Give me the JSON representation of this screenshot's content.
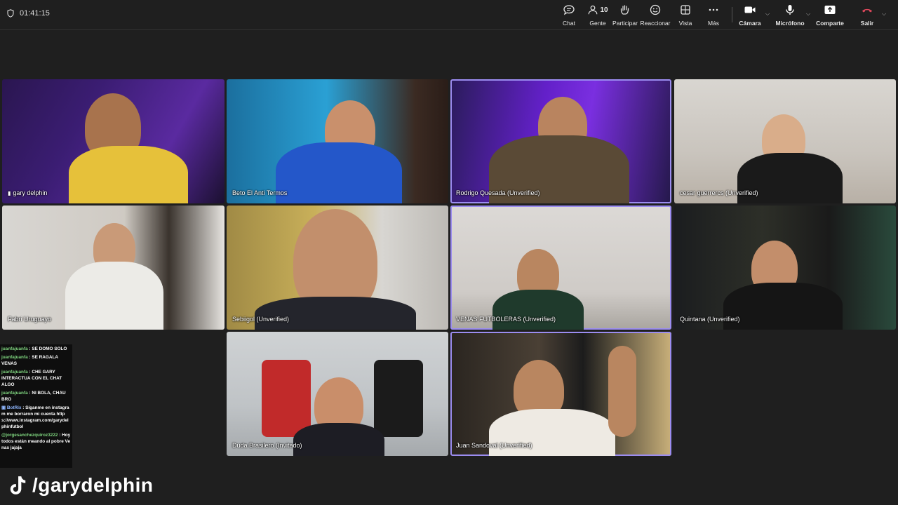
{
  "meeting": {
    "timer": "01:41:15"
  },
  "toolbar": {
    "chat": "Chat",
    "people": "Gente",
    "people_count": "10",
    "raise": "Participar",
    "react": "Reaccionar",
    "view": "Vista",
    "more": "Más",
    "camera": "Cámara",
    "mic": "Micrófono",
    "share": "Comparte",
    "leave": "Salir"
  },
  "participants": [
    {
      "name": "gary delphin"
    },
    {
      "name": "Beto El Anti Termos"
    },
    {
      "name": "Rodrigo Quesada (Unverified)"
    },
    {
      "name": "cesar guerrercs (Unverified)"
    },
    {
      "name": "Fabri Uruguayo"
    },
    {
      "name": "Sebiigol (Unverified)"
    },
    {
      "name": "VENAS FUTBOLERAS (Unverified)"
    },
    {
      "name": "Quintana (Unverified)"
    },
    {
      "name": "Duda Brasilero (Invitado)"
    },
    {
      "name": "Juan Sandoval (Unverified)"
    }
  ],
  "chat": [
    {
      "user": "juanfajuanfa",
      "text": ": SE DOMO SOLO"
    },
    {
      "user": "juanfajuanfa",
      "text": ": SE RAGALA VENAS"
    },
    {
      "user": "juanfajuanfa",
      "text": ": CHE GARY INTERACTUA CON EL CHAT ALGO"
    },
    {
      "user": "juanfajuanfa",
      "text": ": NI BOLA, CHAU BRO"
    },
    {
      "user": "BotRix",
      "text": ": Síganme en instagram me borraron mi cuenta https://www.instagram.com/garydelphinfutbol"
    },
    {
      "user": "@jorgesanchezquiroz3222",
      "text": ": Hoy todos están meando al pobre Venas jajaja"
    }
  ],
  "watermark": {
    "handle": "/garydelphin"
  }
}
